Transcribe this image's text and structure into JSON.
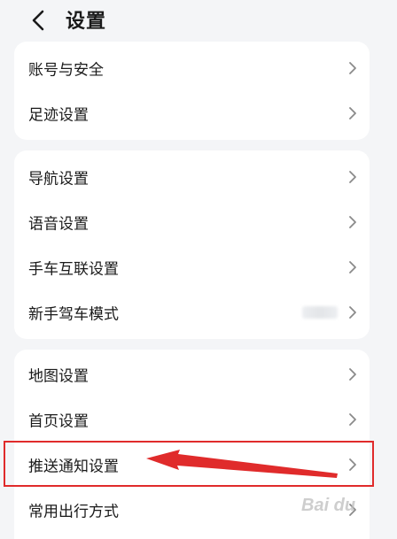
{
  "header": {
    "back_icon": "chevron-left-icon",
    "title": "设置"
  },
  "groups": [
    {
      "items": [
        {
          "label": "账号与安全"
        },
        {
          "label": "足迹设置"
        }
      ]
    },
    {
      "items": [
        {
          "label": "导航设置"
        },
        {
          "label": "语音设置"
        },
        {
          "label": "手车互联设置"
        },
        {
          "label": "新手驾车模式"
        }
      ]
    },
    {
      "items": [
        {
          "label": "地图设置"
        },
        {
          "label": "首页设置"
        },
        {
          "label": "推送通知设置"
        },
        {
          "label": "常用出行方式"
        }
      ]
    }
  ],
  "annotation": {
    "highlight_color": "#e02b2b",
    "highlighted_item": "推送通知设置"
  },
  "watermark": "Bai du"
}
